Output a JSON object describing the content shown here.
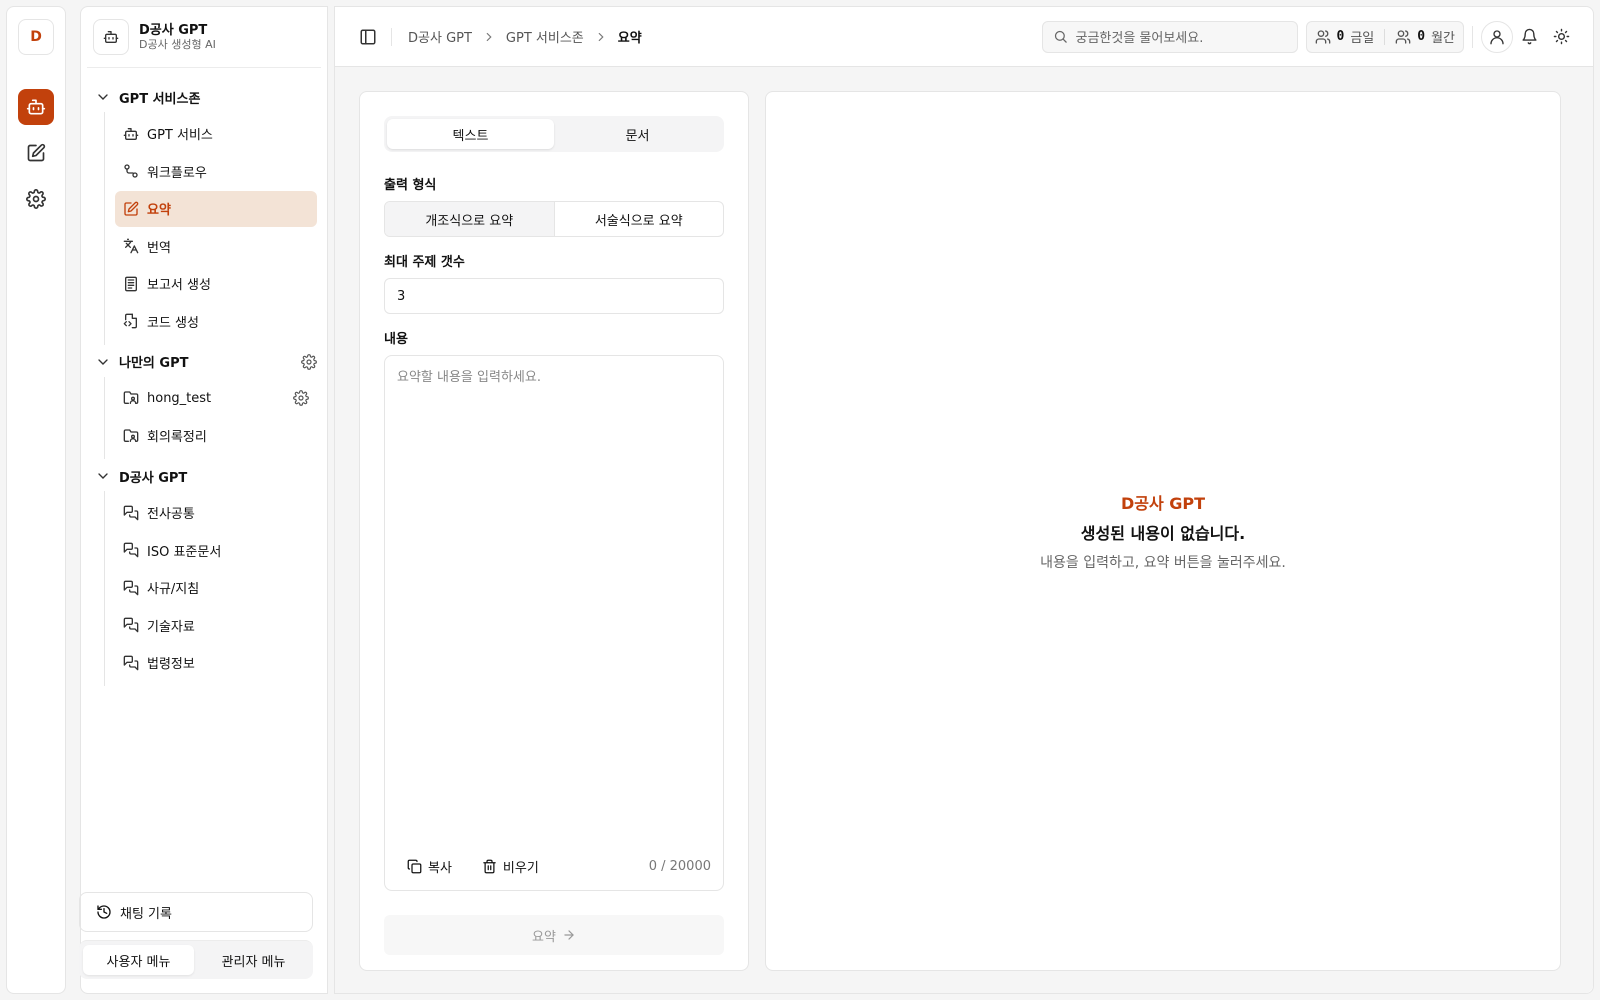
{
  "rail": {
    "avatar": "D"
  },
  "brand": {
    "title": "D공사 GPT",
    "subtitle": "D공사 생성형 AI"
  },
  "nav": {
    "groups": [
      {
        "title": "GPT 서비스존",
        "items": [
          {
            "label": "GPT 서비스",
            "icon": "bot-icon"
          },
          {
            "label": "워크플로우",
            "icon": "workflow-icon"
          },
          {
            "label": "요약",
            "icon": "edit-icon",
            "active": true
          },
          {
            "label": "번역",
            "icon": "translate-icon"
          },
          {
            "label": "보고서 생성",
            "icon": "report-icon"
          },
          {
            "label": "코드 생성",
            "icon": "code-file-icon"
          }
        ]
      },
      {
        "title": "나만의 GPT",
        "items": [
          {
            "label": "hong_test",
            "icon": "folder-user-icon"
          },
          {
            "label": "회의록정리",
            "icon": "folder-user-icon"
          }
        ]
      },
      {
        "title": "D공사 GPT",
        "items": [
          {
            "label": "전사공통",
            "icon": "chat-icon"
          },
          {
            "label": "ISO 표준문서",
            "icon": "chat-icon"
          },
          {
            "label": "사규/지침",
            "icon": "chat-icon"
          },
          {
            "label": "기술자료",
            "icon": "chat-icon"
          },
          {
            "label": "법령정보",
            "icon": "chat-icon"
          }
        ]
      }
    ]
  },
  "sidebar_bottom": {
    "history": "채팅 기록",
    "tabs": [
      "사용자 메뉴",
      "관리자 메뉴"
    ]
  },
  "topbar": {
    "breadcrumb": [
      "D공사 GPT",
      "GPT 서비스존",
      "요약"
    ],
    "search_placeholder": "궁금한것을 물어보세요.",
    "daily_count": "0",
    "daily_label": "금일",
    "monthly_count": "0",
    "monthly_label": "월간"
  },
  "form": {
    "tabs": [
      "텍스트",
      "문서"
    ],
    "output_label": "출력 형식",
    "output_options": [
      "개조식으로 요약",
      "서술식으로 요약"
    ],
    "max_topics_label": "최대 주제 갯수",
    "max_topics_value": "3",
    "content_label": "내용",
    "content_placeholder": "요약할 내용을 입력하세요.",
    "copy": "복사",
    "clear": "비우기",
    "counter": "0 / 20000",
    "submit": "요약"
  },
  "result": {
    "brand": "D공사 GPT",
    "title": "생성된 내용이 없습니다.",
    "desc": "내용을 입력하고, 요약 버튼을 눌러주세요."
  },
  "colors": {
    "accent": "#c2410c",
    "active_bg": "#f3e3d6"
  }
}
